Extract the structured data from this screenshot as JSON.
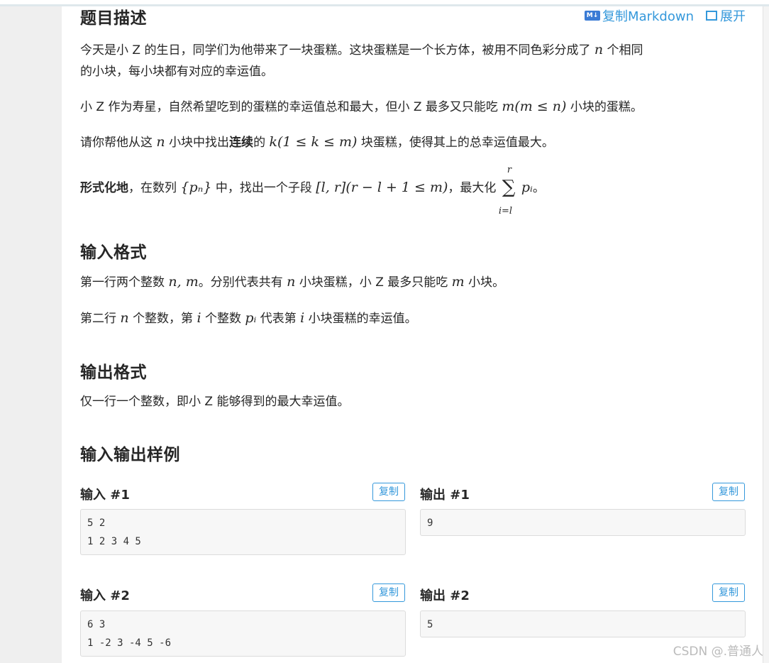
{
  "toolbar": {
    "copy_markdown": "复制Markdown",
    "expand": "展开",
    "md_badge": "M↓"
  },
  "sections": {
    "description": "题目描述",
    "input_format": "输入格式",
    "output_format": "输出格式",
    "samples": "输入输出样例"
  },
  "description": {
    "p1a": "今天是小 Z 的生日，同学们为他带来了一块蛋糕。这块蛋糕是一个长方体，被用不同色彩分成了",
    "p1_n": "n",
    "p1b": "个相同",
    "p1c": "的小块，每小块都有对应的幸运值。",
    "p2a": "小 Z 作为寿星，自然希望吃到的蛋糕的幸运值总和最大，但小 Z 最多又只能吃",
    "p2_math": "m(m ≤ n)",
    "p2b": "小块的蛋糕。",
    "p3a": "请你帮他从这",
    "p3_n": "n",
    "p3b": "小块中找出",
    "p3_bold": "连续",
    "p3c": "的",
    "p3_math": "k(1 ≤ k ≤ m)",
    "p3d": "块蛋糕，使得其上的总幸运值最大。",
    "p4_bold": "形式化地",
    "p4a": "，在数列",
    "p4_seq": "{pₙ}",
    "p4b": "中，找出一个子段",
    "p4_math": "[l, r](r − l + 1 ≤ m)",
    "p4c": "，最大化",
    "p4_sum_up": "r",
    "p4_sum_dn": "i=l",
    "p4_term": "pᵢ",
    "p4d": "。"
  },
  "input_format": {
    "l1a": "第一行两个整数",
    "l1_math": "n, m",
    "l1b": "。分别代表共有",
    "l1_n": "n",
    "l1c": "小块蛋糕，小 Z 最多只能吃",
    "l1_m": "m",
    "l1d": "小块。",
    "l2a": "第二行",
    "l2_n": "n",
    "l2b": "个整数，第",
    "l2_i": "i",
    "l2c": "个整数",
    "l2_p": "pᵢ",
    "l2d": "代表第",
    "l2_i2": "i",
    "l2e": "小块蛋糕的幸运值。"
  },
  "output_format": {
    "l1": "仅一行一个整数，即小 Z 能够得到的最大幸运值。"
  },
  "samples": [
    {
      "in_label": "输入 #1",
      "out_label": "输出 #1",
      "input": "5 2\n1 2 3 4 5",
      "output": "9"
    },
    {
      "in_label": "输入 #2",
      "out_label": "输出 #2",
      "input": "6 3\n1 -2 3 -4 5 -6",
      "output": "5"
    }
  ],
  "copy_label": "复制",
  "watermark": "CSDN @.普通人"
}
